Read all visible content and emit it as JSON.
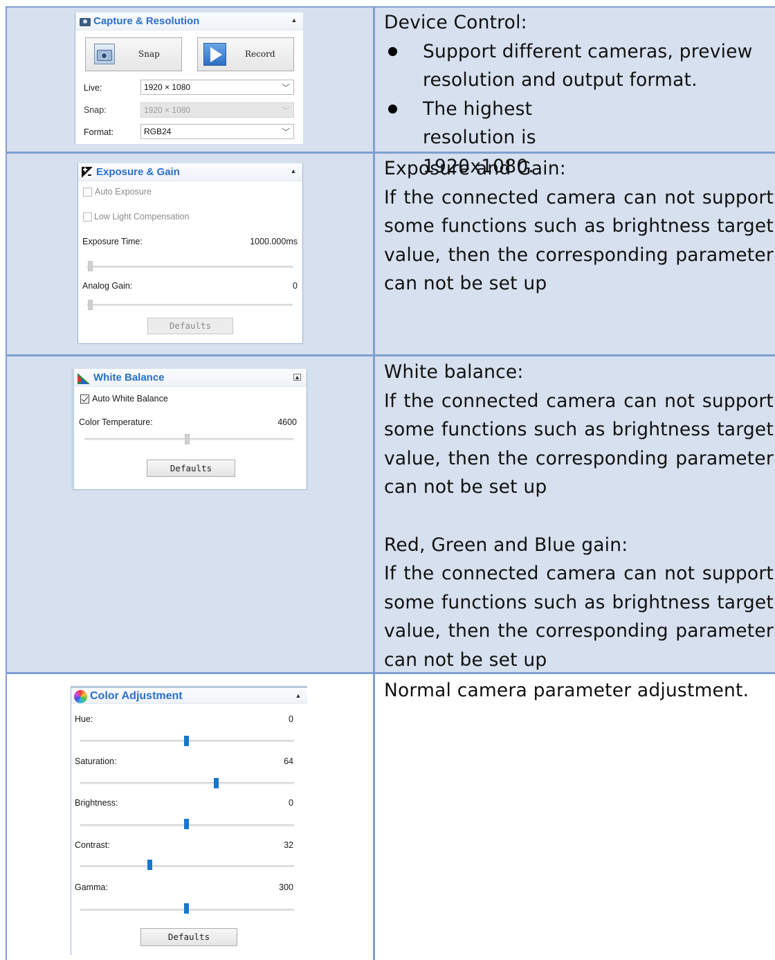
{
  "rows": [
    {
      "panel": {
        "title": "Capture & Resolution",
        "snap_label": "Snap",
        "record_label": "Record",
        "live_label": "Live:",
        "live_value": "1920 × 1080",
        "snap_res_label": "Snap:",
        "snap_res_value": "1920 × 1080",
        "format_label": "Format:",
        "format_value": "RGB24"
      },
      "description": {
        "heading": "Device Control:",
        "bullets": [
          "Support different cameras, preview resolution and output format.",
          "The highest resolution is 1920x1080."
        ]
      }
    },
    {
      "panel": {
        "title": "Exposure & Gain",
        "auto_exposure": "Auto Exposure",
        "low_light": "Low Light Compensation",
        "exposure_time_label": "Exposure Time:",
        "exposure_time_value": "1000.000ms",
        "analog_gain_label": "Analog Gain:",
        "analog_gain_value": "0",
        "defaults_label": "Defaults"
      },
      "description": {
        "heading": "Exposure and Gain:",
        "body": "If the connected camera can not support some functions such as brightness target value, then the corresponding parameter can not be set up"
      }
    },
    {
      "panel": {
        "title": "White Balance",
        "auto_white_balance": "Auto White Balance",
        "color_temp_label": "Color Temperature:",
        "color_temp_value": "4600",
        "defaults_label": "Defaults"
      },
      "description": {
        "heading": "White balance:",
        "body": "If the connected camera can not support some functions such as brightness target value, then the corresponding parameter can not be set up",
        "heading2": "Red, Green and Blue gain:",
        "body2": "If the connected camera can not support some functions such as brightness target value, then the corresponding parameter can not be set up"
      }
    },
    {
      "panel": {
        "title": "Color Adjustment",
        "sliders": [
          {
            "label": "Hue:",
            "value": "0"
          },
          {
            "label": "Saturation:",
            "value": "64"
          },
          {
            "label": "Brightness:",
            "value": "0"
          },
          {
            "label": "Contrast:",
            "value": "32"
          },
          {
            "label": "Gamma:",
            "value": "300"
          }
        ],
        "defaults_label": "Defaults"
      },
      "description": {
        "body": "Normal camera parameter adjustment."
      }
    }
  ],
  "colors": {
    "row_fill": "#d6e0ee",
    "grid": "#7f9fcf",
    "panel_title": "#2a6fc9",
    "slider_thumb": "#1677d2"
  }
}
